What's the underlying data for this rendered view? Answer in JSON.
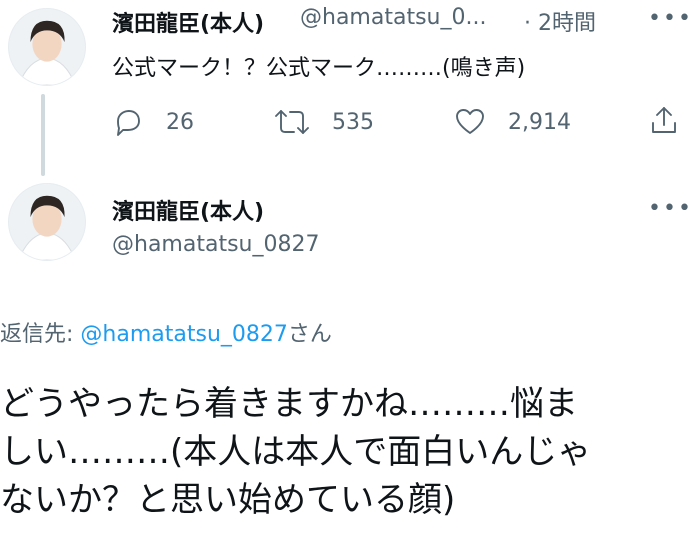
{
  "first_tweet": {
    "name": "濱田龍臣(本人)",
    "handle": "@hamatatsu_0...",
    "time": "· 2時間",
    "more": "•••",
    "text": "公式マーク！？公式マーク………(鳴き声)",
    "actions": {
      "reply_count": "26",
      "retweet_count": "535",
      "like_count": "2,914"
    }
  },
  "main_tweet": {
    "name": "濱田龍臣(本人)",
    "handle": "@hamatatsu_0827",
    "more": "•••",
    "reply_to_label": "返信先: ",
    "reply_to_handle": "@hamatatsu_0827",
    "reply_to_suffix": "さん",
    "text_line1": "どうやったら着きますかね………悩ま",
    "text_line2": "しい………(本人は本人で面白いんじゃ",
    "text_line3": "ないか？と思い始めている顔)"
  }
}
